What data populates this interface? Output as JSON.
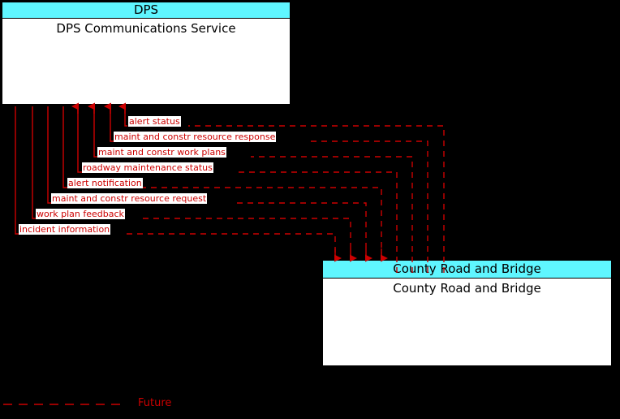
{
  "diagram": {
    "title": "DPS Communications Service to County Road and Bridge interface diagram",
    "background_color": "#000000",
    "flow_color": "#cc0000",
    "node_title_color": "#5ff6ff",
    "node_body_color": "#ffffff"
  },
  "nodes": [
    {
      "id": "dps",
      "title": "DPS",
      "body": "DPS Communications Service"
    },
    {
      "id": "county",
      "title": "County Road and Bridge",
      "body": "County Road and Bridge"
    }
  ],
  "flows": [
    {
      "label": "alert status",
      "direction": "to-dps"
    },
    {
      "label": "maint and constr resource response",
      "direction": "to-dps"
    },
    {
      "label": "maint and constr work plans",
      "direction": "to-dps"
    },
    {
      "label": "roadway maintenance status",
      "direction": "to-dps"
    },
    {
      "label": "alert notification",
      "direction": "to-county"
    },
    {
      "label": "maint and constr resource request",
      "direction": "to-county"
    },
    {
      "label": "work plan feedback",
      "direction": "to-county"
    },
    {
      "label": "incident information",
      "direction": "to-county"
    }
  ],
  "legend": {
    "entries": [
      {
        "label": "Future",
        "style": "dashed",
        "color": "#cc0000"
      }
    ]
  }
}
